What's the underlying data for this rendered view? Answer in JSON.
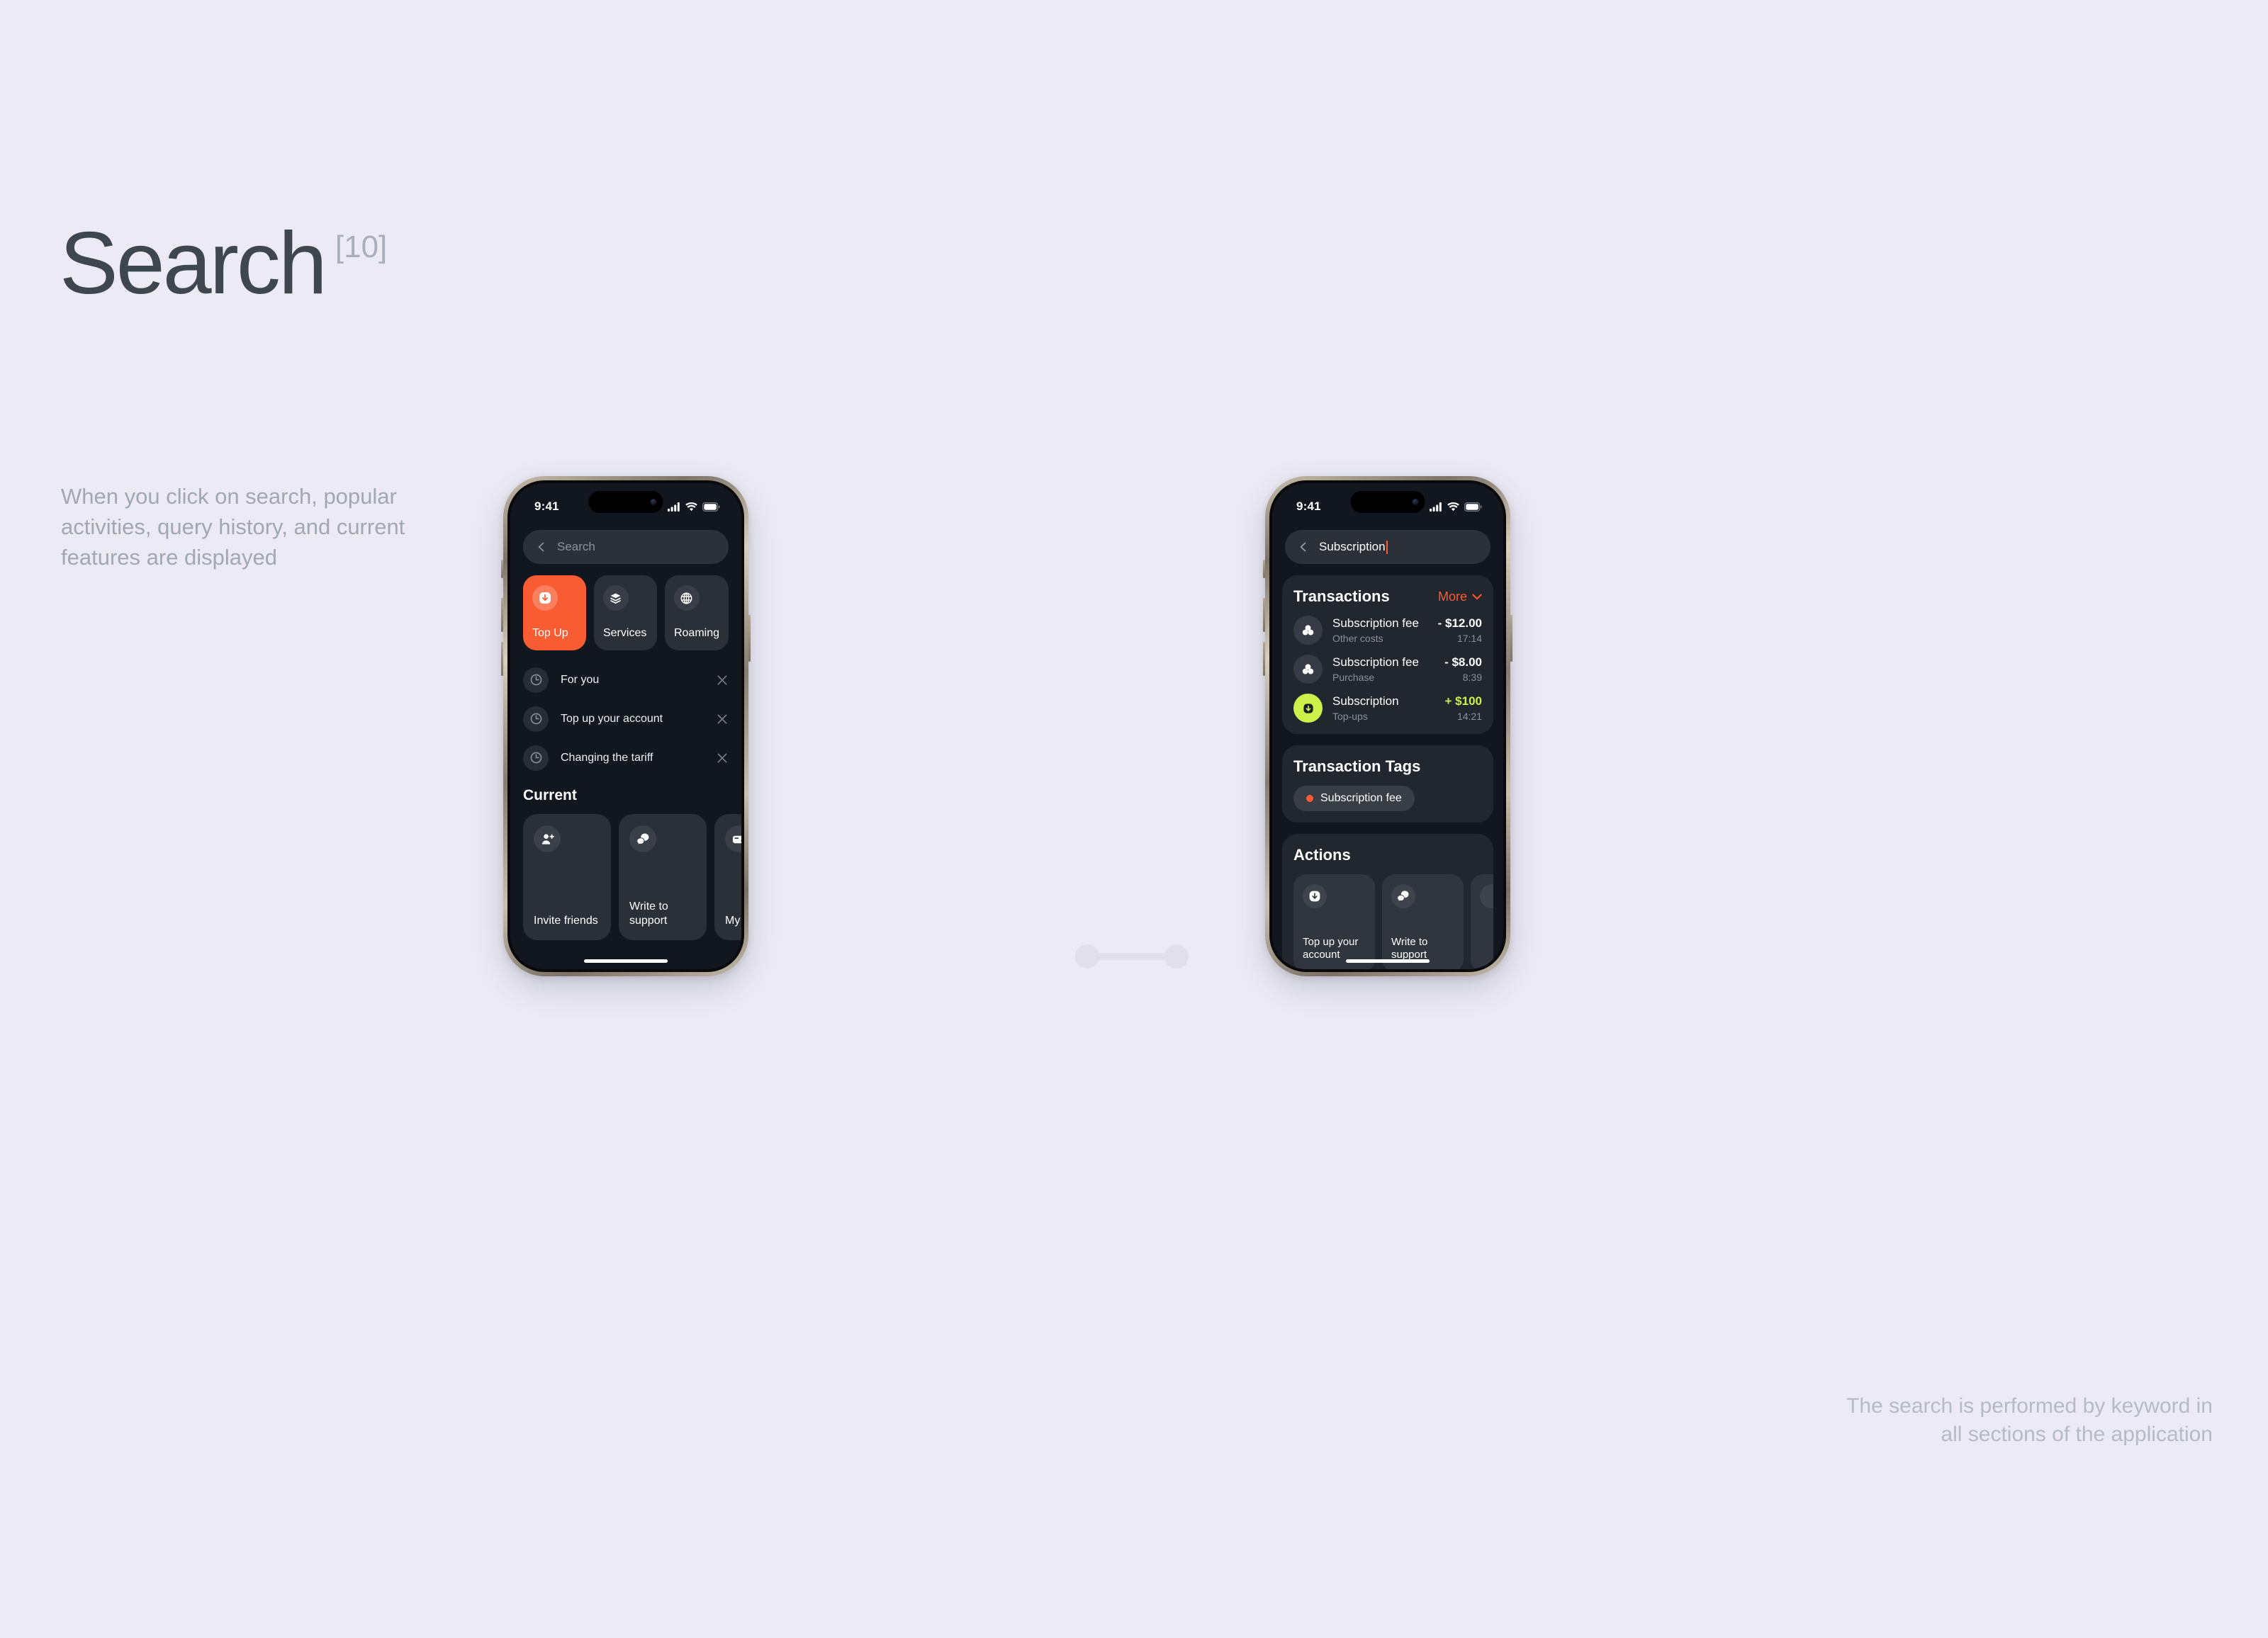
{
  "page": {
    "title": "Search",
    "title_superscript": "[10]",
    "lede": "When you click on search, popular activities, query history, and current features are displayed",
    "footnote": "The search is performed by keyword in all sections of the application",
    "background": "#ecebf5",
    "accent_orange": "#f95c33",
    "accent_lime": "#cdf04a"
  },
  "phone1": {
    "status": {
      "time": "9:41",
      "signal_icon": "cellular-bars-icon",
      "wifi_icon": "wifi-icon",
      "battery_icon": "battery-icon"
    },
    "search": {
      "placeholder": "Search",
      "value": "",
      "back_icon": "back-chevron-icon"
    },
    "chips": [
      {
        "label": "Top Up",
        "icon": "download-arrow-icon",
        "accent": true
      },
      {
        "label": "Services",
        "icon": "layers-icon",
        "accent": false
      },
      {
        "label": "Roaming",
        "icon": "globe-icon",
        "accent": false
      }
    ],
    "history": [
      {
        "label": "For you",
        "icon": "clock-icon",
        "clear_icon": "close-icon"
      },
      {
        "label": "Top up your account",
        "icon": "clock-icon",
        "clear_icon": "close-icon"
      },
      {
        "label": "Changing the tariff",
        "icon": "clock-icon",
        "clear_icon": "close-icon"
      }
    ],
    "current": {
      "title": "Current",
      "cards": [
        {
          "label": "Invite friends",
          "icon": "person-add-icon"
        },
        {
          "label": "Write to support",
          "icon": "chat-bubbles-icon"
        },
        {
          "label": "My",
          "icon": "card-icon"
        }
      ]
    }
  },
  "phone2": {
    "status": {
      "time": "9:41",
      "signal_icon": "cellular-bars-icon",
      "wifi_icon": "wifi-icon",
      "battery_icon": "battery-icon"
    },
    "search": {
      "placeholder": "Search",
      "value": "Subscription",
      "back_icon": "back-chevron-icon"
    },
    "transactions": {
      "title": "Transactions",
      "more_label": "More",
      "more_icon": "chevron-down-icon",
      "rows": [
        {
          "name": "Subscription fee",
          "category": "Other costs",
          "amount": "- $12.00",
          "time": "17:14",
          "positive": false,
          "icon": "group-circles-icon"
        },
        {
          "name": "Subscription fee",
          "category": "Purchase",
          "amount": "- $8.00",
          "time": "8:39",
          "positive": false,
          "icon": "group-circles-icon"
        },
        {
          "name": "Subscription",
          "category": "Top-ups",
          "amount": "+ $100",
          "time": "14:21",
          "positive": true,
          "icon": "download-arrow-icon"
        }
      ]
    },
    "tags": {
      "title": "Transaction Tags",
      "items": [
        {
          "label": "Subscription fee",
          "dot_color": "#f95c33"
        }
      ]
    },
    "actions": {
      "title": "Actions",
      "cards": [
        {
          "label": "Top up your account",
          "icon": "download-arrow-icon"
        },
        {
          "label": "Write to support",
          "icon": "chat-bubbles-icon"
        },
        {
          "label": "",
          "icon": "partial-card-icon"
        }
      ]
    }
  }
}
